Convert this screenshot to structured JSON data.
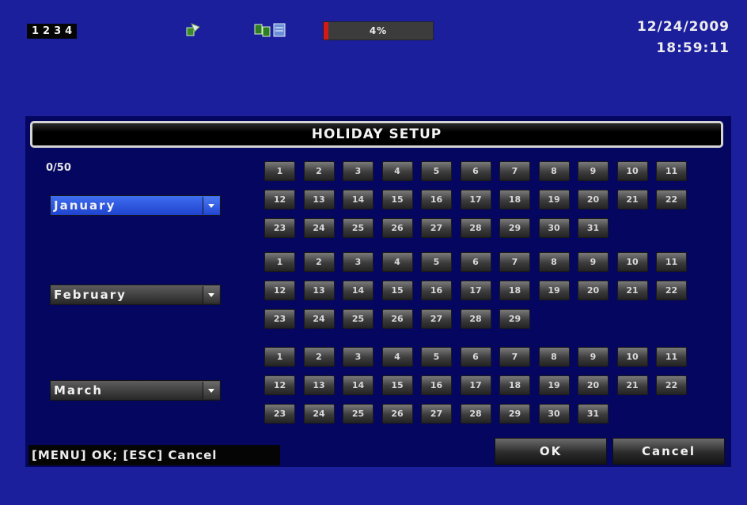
{
  "status_bar": {
    "channels": [
      "1",
      "2",
      "3",
      "4"
    ],
    "progress_label": "4%",
    "progress_value": 0.04,
    "date": "12/24/2009",
    "time": "18:59:11",
    "icons": [
      "network-icon",
      "record-icon"
    ],
    "progress_color": "#d21a1a"
  },
  "dialog": {
    "title": "HOLIDAY SETUP",
    "count": "0/50",
    "hint": "[MENU] OK; [ESC] Cancel",
    "ok_label": "OK",
    "cancel_label": "Cancel"
  },
  "months": [
    {
      "name": "January",
      "days": [
        "1",
        "2",
        "3",
        "4",
        "5",
        "6",
        "7",
        "8",
        "9",
        "10",
        "11",
        "12",
        "13",
        "14",
        "15",
        "16",
        "17",
        "18",
        "19",
        "20",
        "21",
        "22",
        "23",
        "24",
        "25",
        "26",
        "27",
        "28",
        "29",
        "30",
        "31"
      ],
      "selected": true
    },
    {
      "name": "February",
      "days": [
        "1",
        "2",
        "3",
        "4",
        "5",
        "6",
        "7",
        "8",
        "9",
        "10",
        "11",
        "12",
        "13",
        "14",
        "15",
        "16",
        "17",
        "18",
        "19",
        "20",
        "21",
        "22",
        "23",
        "24",
        "25",
        "26",
        "27",
        "28",
        "29"
      ],
      "selected": false
    },
    {
      "name": "March",
      "days": [
        "1",
        "2",
        "3",
        "4",
        "5",
        "6",
        "7",
        "8",
        "9",
        "10",
        "11",
        "12",
        "13",
        "14",
        "15",
        "16",
        "17",
        "18",
        "19",
        "20",
        "21",
        "22",
        "23",
        "24",
        "25",
        "26",
        "27",
        "28",
        "29",
        "30",
        "31"
      ],
      "selected": false
    }
  ],
  "colors": {
    "background": "#1c1f9c",
    "dialog": "#05065f",
    "select_active": "#2f57e0"
  }
}
